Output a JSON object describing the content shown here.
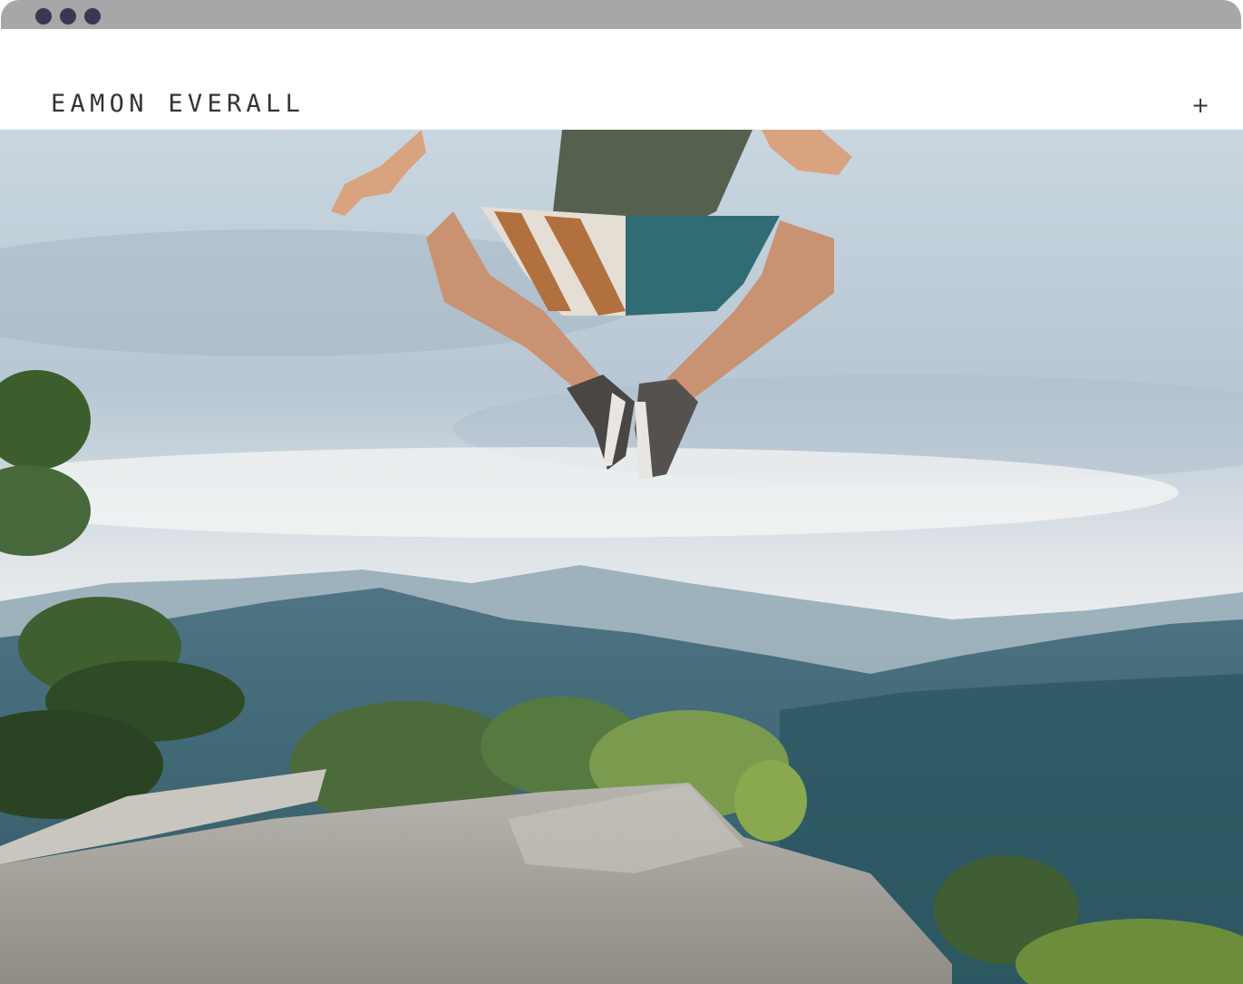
{
  "window": {
    "controls": [
      "close-dot",
      "minimize-dot",
      "zoom-dot"
    ]
  },
  "header": {
    "brand": "EAMON EVERALL",
    "menu_icon": "+"
  },
  "hero": {
    "description_icon": "hero-photo"
  },
  "colors": {
    "titlebar": "#a7a6a8",
    "window_dots": "#3d3650",
    "text": "#333333",
    "background": "#ffffff"
  }
}
